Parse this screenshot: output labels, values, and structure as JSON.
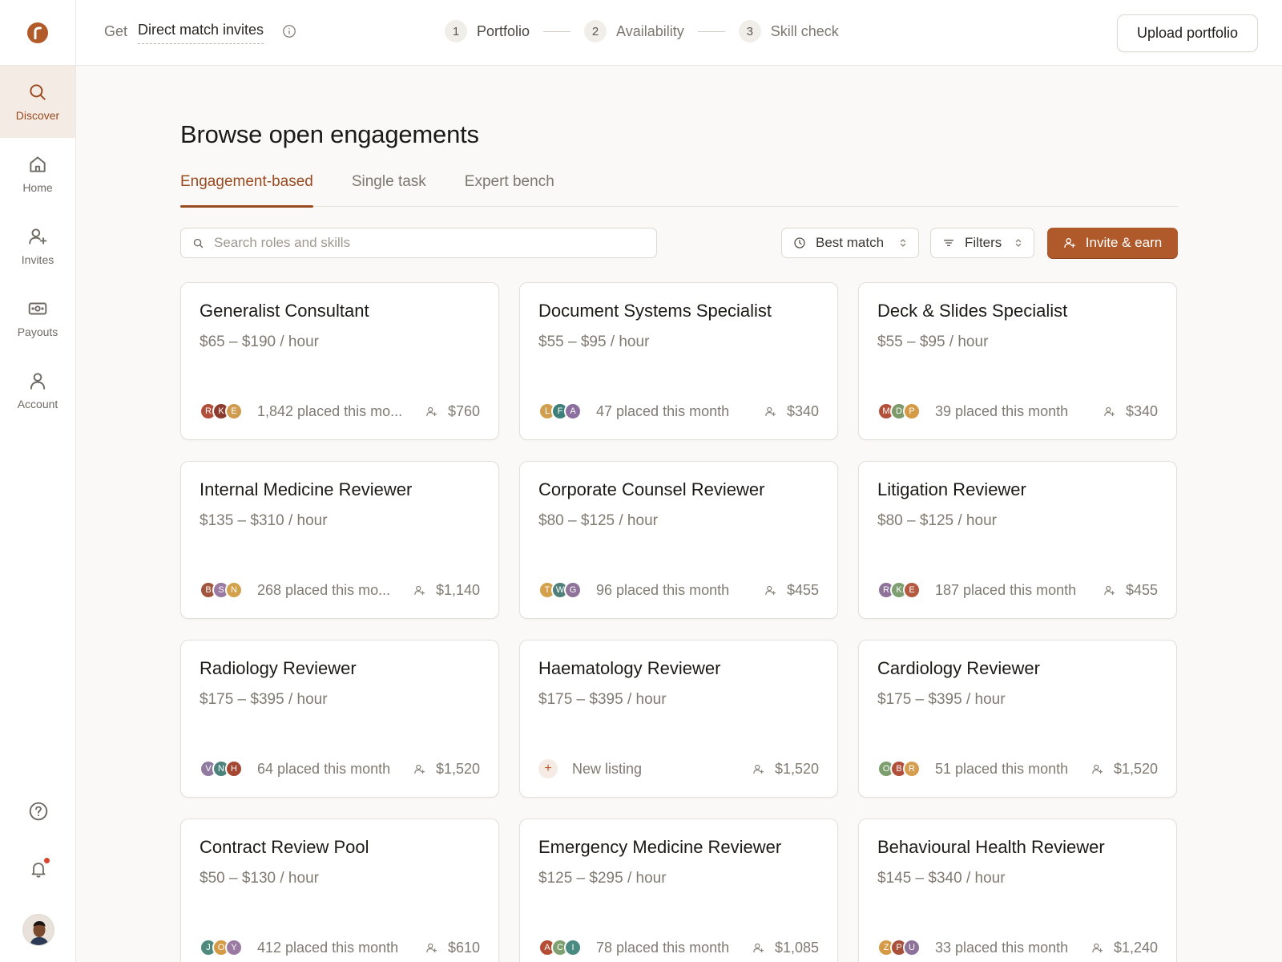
{
  "topbar": {
    "get_label": "Get",
    "invite_link": "Direct match invites",
    "steps": [
      {
        "num": "1",
        "label": "Portfolio"
      },
      {
        "num": "2",
        "label": "Availability"
      },
      {
        "num": "3",
        "label": "Skill check"
      }
    ],
    "upload_label": "Upload portfolio"
  },
  "sidebar": {
    "items": [
      {
        "label": "Discover",
        "icon": "search-icon",
        "active": true
      },
      {
        "label": "Home",
        "icon": "home-icon"
      },
      {
        "label": "Invites",
        "icon": "user-plus-icon"
      },
      {
        "label": "Payouts",
        "icon": "cash-icon"
      },
      {
        "label": "Account",
        "icon": "user-icon"
      }
    ],
    "bottom_icons": [
      "help-icon",
      "bell-icon",
      "avatar"
    ]
  },
  "main": {
    "title": "Browse open engagements",
    "tabs": [
      {
        "label": "Engagement-based",
        "active": true
      },
      {
        "label": "Single task"
      },
      {
        "label": "Expert bench"
      }
    ],
    "search_placeholder": "Search roles and skills",
    "sort_label": "Best match",
    "filter_label": "Filters",
    "invite_label": "Invite & earn"
  },
  "colors": {
    "accent": "#b05a2b",
    "accent_text": "#9a4a1f",
    "active_bg": "#f4ebe5"
  },
  "cards": [
    {
      "title": "Generalist Consultant",
      "rate": "$65 – $190 / hour",
      "placed": "1,842 placed this mo...",
      "reward": "$760",
      "avatars": [
        {
          "i": "R",
          "c": "#b24f3a"
        },
        {
          "i": "K",
          "c": "#8d3b2e"
        },
        {
          "i": "E",
          "c": "#d09a4f"
        }
      ]
    },
    {
      "title": "Document Systems Specialist",
      "rate": "$55 – $95 / hour",
      "placed": "47 placed this month",
      "reward": "$340",
      "avatars": [
        {
          "i": "L",
          "c": "#d0a050"
        },
        {
          "i": "F",
          "c": "#3e7f7a"
        },
        {
          "i": "A",
          "c": "#8b6f9e"
        }
      ]
    },
    {
      "title": "Deck & Slides Specialist",
      "rate": "$55 – $95 / hour",
      "placed": "39 placed this month",
      "reward": "$340",
      "avatars": [
        {
          "i": "M",
          "c": "#b2503a"
        },
        {
          "i": "D",
          "c": "#7c9a6a"
        },
        {
          "i": "P",
          "c": "#d49a45"
        }
      ]
    },
    {
      "title": "Internal Medicine Reviewer",
      "rate": "$135 – $310 / hour",
      "placed": "268 placed this mo...",
      "reward": "$1,140",
      "avatars": [
        {
          "i": "B",
          "c": "#a0553c"
        },
        {
          "i": "S",
          "c": "#9a7aa2"
        },
        {
          "i": "N",
          "c": "#d3a14b"
        }
      ]
    },
    {
      "title": "Corporate Counsel Reviewer",
      "rate": "$80 – $125 / hour",
      "placed": "96 placed this month",
      "reward": "$455",
      "avatars": [
        {
          "i": "T",
          "c": "#d4a04e"
        },
        {
          "i": "W",
          "c": "#4f807a"
        },
        {
          "i": "G",
          "c": "#8e729a"
        }
      ]
    },
    {
      "title": "Litigation Reviewer",
      "rate": "$80 – $125 / hour",
      "placed": "187 placed this month",
      "reward": "$455",
      "avatars": [
        {
          "i": "R",
          "c": "#8e729a"
        },
        {
          "i": "K",
          "c": "#7d9f72"
        },
        {
          "i": "E",
          "c": "#b35a41"
        }
      ]
    },
    {
      "title": "Radiology Reviewer",
      "rate": "$175 – $395 / hour",
      "placed": "64 placed this month",
      "reward": "$1,520",
      "avatars": [
        {
          "i": "V",
          "c": "#917a9f"
        },
        {
          "i": "N",
          "c": "#4c847c"
        },
        {
          "i": "H",
          "c": "#a54631"
        }
      ]
    },
    {
      "title": "Haematology Reviewer",
      "rate": "$175 – $395 / hour",
      "placed": "New listing",
      "reward": "$1,520",
      "new": true,
      "avatars": []
    },
    {
      "title": "Cardiology Reviewer",
      "rate": "$175 – $395 / hour",
      "placed": "51 placed this month",
      "reward": "$1,520",
      "avatars": [
        {
          "i": "O",
          "c": "#7c9e6d"
        },
        {
          "i": "B",
          "c": "#b24f3a"
        },
        {
          "i": "R",
          "c": "#d59e4f"
        }
      ]
    },
    {
      "title": "Contract Review Pool",
      "rate": "$50 – $130 / hour",
      "placed": "412 placed this month",
      "reward": "$610",
      "avatars": [
        {
          "i": "J",
          "c": "#4f8a7e"
        },
        {
          "i": "O",
          "c": "#d49a45"
        },
        {
          "i": "Y",
          "c": "#9a7aa2"
        }
      ]
    },
    {
      "title": "Emergency Medicine Reviewer",
      "rate": "$125 – $295 / hour",
      "placed": "78 placed this month",
      "reward": "$1,085",
      "avatars": [
        {
          "i": "A",
          "c": "#b34e35"
        },
        {
          "i": "C",
          "c": "#7fa070"
        },
        {
          "i": "I",
          "c": "#4b8a80"
        }
      ]
    },
    {
      "title": "Behavioural Health Reviewer",
      "rate": "$145 – $340 / hour",
      "placed": "33 placed this month",
      "reward": "$1,240",
      "avatars": [
        {
          "i": "Z",
          "c": "#d49a45"
        },
        {
          "i": "P",
          "c": "#a8503a"
        },
        {
          "i": "U",
          "c": "#8e729a"
        }
      ]
    }
  ]
}
